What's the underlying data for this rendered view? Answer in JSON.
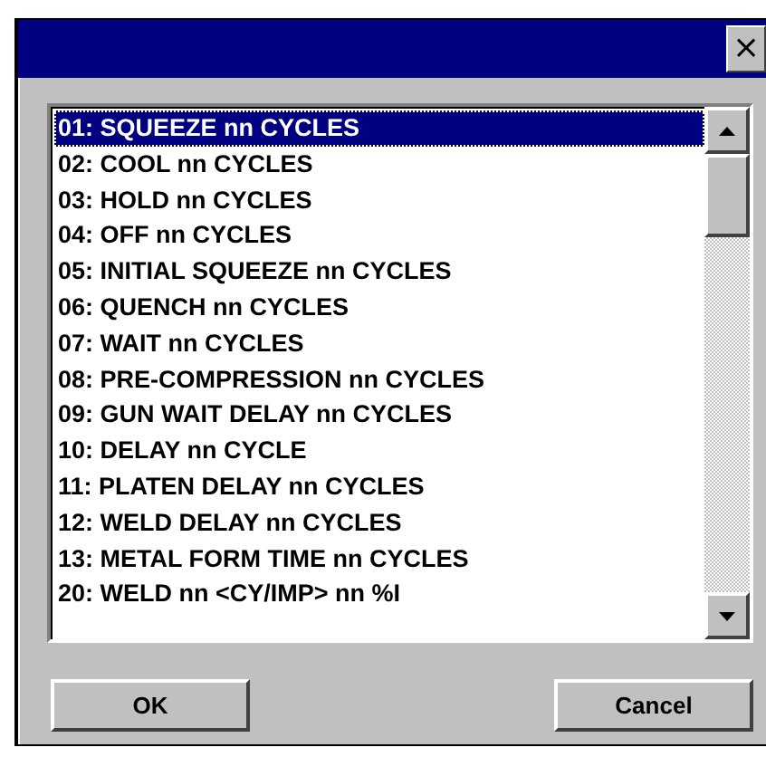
{
  "window": {
    "close_button": "×"
  },
  "list": {
    "items": [
      {
        "label": "01: SQUEEZE nn CYCLES",
        "selected": true
      },
      {
        "label": "02: COOL nn CYCLES",
        "selected": false
      },
      {
        "label": "03: HOLD nn CYCLES",
        "selected": false
      },
      {
        "label": "04: OFF nn CYCLES",
        "selected": false
      },
      {
        "label": "05: INITIAL SQUEEZE nn CYCLES",
        "selected": false
      },
      {
        "label": "06: QUENCH nn CYCLES",
        "selected": false
      },
      {
        "label": "07: WAIT nn CYCLES",
        "selected": false
      },
      {
        "label": "08: PRE-COMPRESSION nn CYCLES",
        "selected": false
      },
      {
        "label": "09: GUN WAIT DELAY nn CYCLES",
        "selected": false
      },
      {
        "label": "10: DELAY nn CYCLE",
        "selected": false
      },
      {
        "label": "11: PLATEN DELAY nn CYCLES",
        "selected": false
      },
      {
        "label": "12: WELD DELAY nn CYCLES",
        "selected": false
      },
      {
        "label": "13: METAL FORM TIME nn CYCLES",
        "selected": false
      },
      {
        "label": "20: WELD nn <CY/IMP> nn %I",
        "selected": false
      }
    ]
  },
  "buttons": [
    "OK",
    "Cancel"
  ]
}
